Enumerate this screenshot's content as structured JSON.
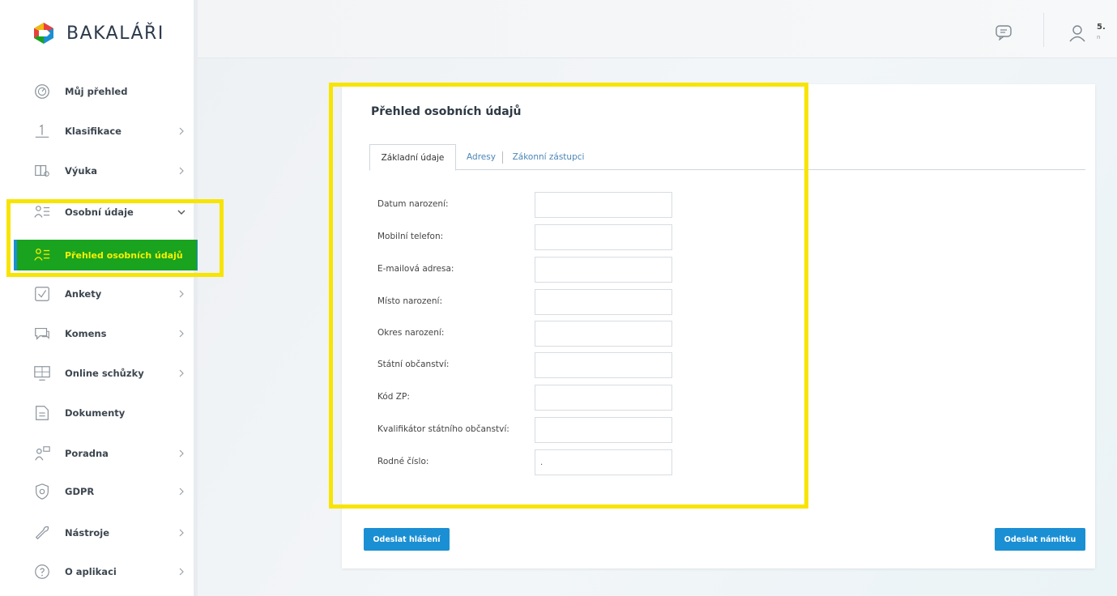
{
  "app": {
    "name": "BAKALÁŘI",
    "brand_colors": [
      "#e8413c",
      "#1c8fd1",
      "#1aa31f",
      "#f2b90f"
    ]
  },
  "sidebar": {
    "items": [
      {
        "label": "Můj přehled",
        "icon": "gauge-icon",
        "chevron": ""
      },
      {
        "label": "Klasifikace",
        "icon": "grade-one-icon",
        "chevron": "right"
      },
      {
        "label": "Výuka",
        "icon": "books-icon",
        "chevron": "right"
      },
      {
        "label": "Osobní údaje",
        "icon": "people-list-icon",
        "chevron": "down"
      },
      {
        "label": "Přehled osobních údajů",
        "icon": "people-list-icon",
        "chevron": "",
        "active": true
      },
      {
        "label": "Ankety",
        "icon": "checkbox-icon",
        "chevron": "right"
      },
      {
        "label": "Komens",
        "icon": "chat-icon",
        "chevron": "right"
      },
      {
        "label": "Online schůzky",
        "icon": "video-meeting-icon",
        "chevron": "right"
      },
      {
        "label": "Dokumenty",
        "icon": "document-icon",
        "chevron": ""
      },
      {
        "label": "Poradna",
        "icon": "counseling-icon",
        "chevron": "right"
      },
      {
        "label": "GDPR",
        "icon": "shield-icon",
        "chevron": "right"
      },
      {
        "label": "Nástroje",
        "icon": "wrench-icon",
        "chevron": "right"
      },
      {
        "label": "O aplikaci",
        "icon": "question-icon",
        "chevron": "right"
      }
    ]
  },
  "topbar": {
    "message_icon": "message-icon",
    "user_icon": "user-icon",
    "username": "5.",
    "user_sub": "n"
  },
  "card": {
    "title": "Přehled osobních údajů",
    "tabs": [
      {
        "label": "Základní údaje",
        "active": true
      },
      {
        "label": "Adresy",
        "active": false
      },
      {
        "label": "Zákonní zástupci",
        "active": false
      }
    ],
    "fields": [
      {
        "label": "Datum narození:",
        "value": ""
      },
      {
        "label": "Mobilní telefon:",
        "value": ""
      },
      {
        "label": "E-mailová adresa:",
        "value": ""
      },
      {
        "label": "Místo narození:",
        "value": ""
      },
      {
        "label": "Okres narození:",
        "value": ""
      },
      {
        "label": "Státní občanství:",
        "value": ""
      },
      {
        "label": "Kód ZP:",
        "value": ""
      },
      {
        "label": "Kvalifikátor státního občanství:",
        "value": ""
      },
      {
        "label": "Rodné číslo:",
        "value": "."
      }
    ],
    "buttons": {
      "report": "Odeslat hlášení",
      "objection": "Odeslat námitku"
    }
  },
  "annotation_color": "#f7e400"
}
